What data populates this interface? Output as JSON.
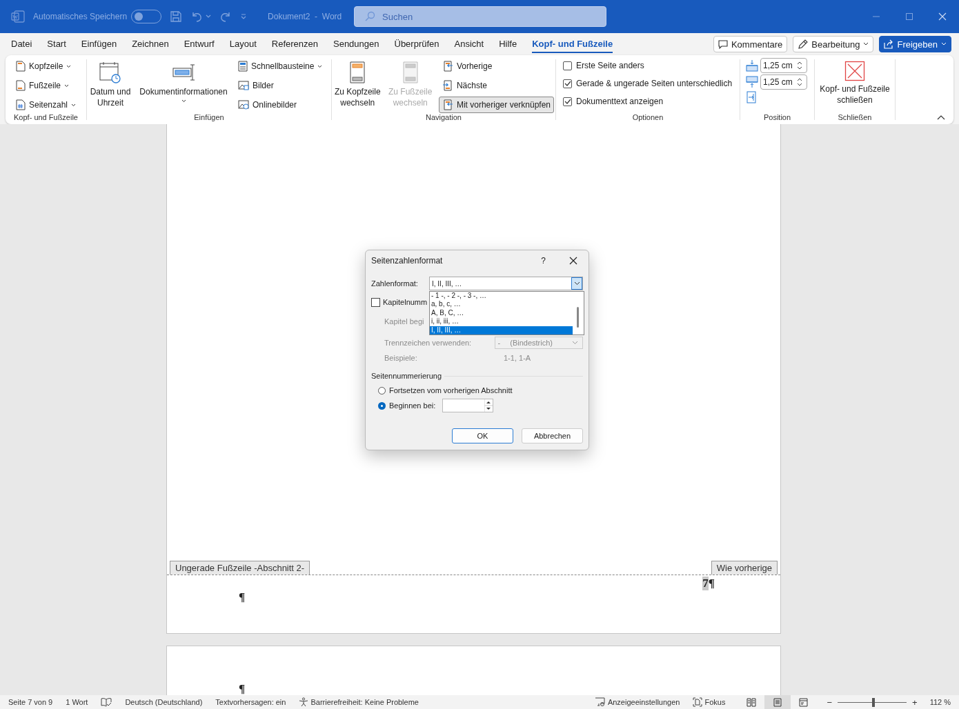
{
  "titlebar": {
    "autosave_label": "Automatisches Speichern",
    "autosave_on": false,
    "document_title": "Dokument2  -  Word",
    "search": {
      "placeholder": "Suchen"
    }
  },
  "menu_tabs": [
    {
      "label": "Datei",
      "selected": false
    },
    {
      "label": "Start",
      "selected": false
    },
    {
      "label": "Einfügen",
      "selected": false
    },
    {
      "label": "Zeichnen",
      "selected": false
    },
    {
      "label": "Entwurf",
      "selected": false
    },
    {
      "label": "Layout",
      "selected": false
    },
    {
      "label": "Referenzen",
      "selected": false
    },
    {
      "label": "Sendungen",
      "selected": false
    },
    {
      "label": "Überprüfen",
      "selected": false
    },
    {
      "label": "Ansicht",
      "selected": false
    },
    {
      "label": "Hilfe",
      "selected": false
    },
    {
      "label": "Kopf- und Fußzeile",
      "selected": true
    }
  ],
  "header_buttons": {
    "comments": "Kommentare",
    "editing": "Bearbeitung",
    "share": "Freigeben"
  },
  "ribbon": {
    "header_footer": {
      "label": "Kopf- und Fußzeile",
      "items": [
        {
          "label": "Kopfzeile"
        },
        {
          "label": "Fußzeile"
        },
        {
          "label": "Seitenzahl"
        }
      ]
    },
    "insert": {
      "label": "Einfügen",
      "large": [
        {
          "label": "Datum und Uhrzeit"
        },
        {
          "label": "Dokumentinformationen"
        }
      ],
      "small": [
        {
          "label": "Schnellbausteine"
        },
        {
          "label": "Bilder"
        },
        {
          "label": "Onlinebilder"
        }
      ]
    },
    "navigation": {
      "label": "Navigation",
      "large": [
        {
          "label": "Zu Kopfzeile wechseln",
          "disabled": false
        },
        {
          "label": "Zu Fußzeile wechseln",
          "disabled": true
        }
      ],
      "small": [
        {
          "label": "Vorherige",
          "selected": false
        },
        {
          "label": "Nächste",
          "selected": false
        },
        {
          "label": "Mit vorheriger verknüpfen",
          "selected": true
        }
      ]
    },
    "options": {
      "label": "Optionen",
      "items": [
        {
          "label": "Erste Seite anders",
          "checked": false
        },
        {
          "label": "Gerade & ungerade Seiten unterschiedlich",
          "checked": true
        },
        {
          "label": "Dokumenttext anzeigen",
          "checked": true
        }
      ]
    },
    "position": {
      "label": "Position",
      "spinners": [
        {
          "value": "1,25 cm"
        },
        {
          "value": "1,25 cm"
        }
      ]
    },
    "close": {
      "label": "Schließen",
      "button": "Kopf- und Fußzeile schließen"
    }
  },
  "document": {
    "footer_tag": "Ungerade Fußzeile -Abschnitt 2-",
    "link_tag": "Wie vorherige",
    "page_number": "7",
    "page_number_mark": "¶",
    "footer_mark": "¶",
    "page2_mark": "¶"
  },
  "dialog": {
    "title": "Seitenzahlenformat",
    "help": "?",
    "number_format": {
      "label": "Zahlenformat:",
      "value": "I, II, III, …",
      "options": [
        {
          "label": "- 1 -, - 2 -, - 3 -, …",
          "selected": false
        },
        {
          "label": "a, b, c, …",
          "selected": false
        },
        {
          "label": "A, B, C, …",
          "selected": false
        },
        {
          "label": "i, ii, iii, …",
          "selected": false
        },
        {
          "label": "I, II, III, …",
          "selected": true
        }
      ]
    },
    "chapter": {
      "label": "Kapitelnumm",
      "checked": false
    },
    "chapter_start": {
      "label": "Kapitel begi",
      "disabled": true
    },
    "separator": {
      "label": "Trennzeichen verwenden:",
      "value": "-",
      "note": "(Bindestrich)",
      "disabled": true
    },
    "examples": {
      "label": "Beispiele:",
      "value": "1-1, 1-A",
      "disabled": true
    },
    "numbering": {
      "label": "Seitennummerierung",
      "options": [
        {
          "label": "Fortsetzen vom vorherigen Abschnitt",
          "selected": false
        },
        {
          "label": "Beginnen bei:",
          "selected": true
        }
      ]
    },
    "buttons": [
      {
        "label": "OK",
        "default": true
      },
      {
        "label": "Abbrechen",
        "default": false
      }
    ]
  },
  "status_bar": {
    "page": "Seite 7 von 9",
    "words": "1 Wort",
    "language": "Deutsch (Deutschland)",
    "predictions": "Textvorhersagen: ein",
    "accessibility": "Barrierefreiheit: Keine Probleme",
    "display_settings": "Anzeigeeinstellungen",
    "focus": "Fokus",
    "views": [
      {
        "selected": false
      },
      {
        "selected": true
      },
      {
        "selected": false
      }
    ],
    "zoom_out": "−",
    "zoom_in": "+",
    "zoom": {
      "level": 0.52
    },
    "zoom_label": "112 %"
  }
}
